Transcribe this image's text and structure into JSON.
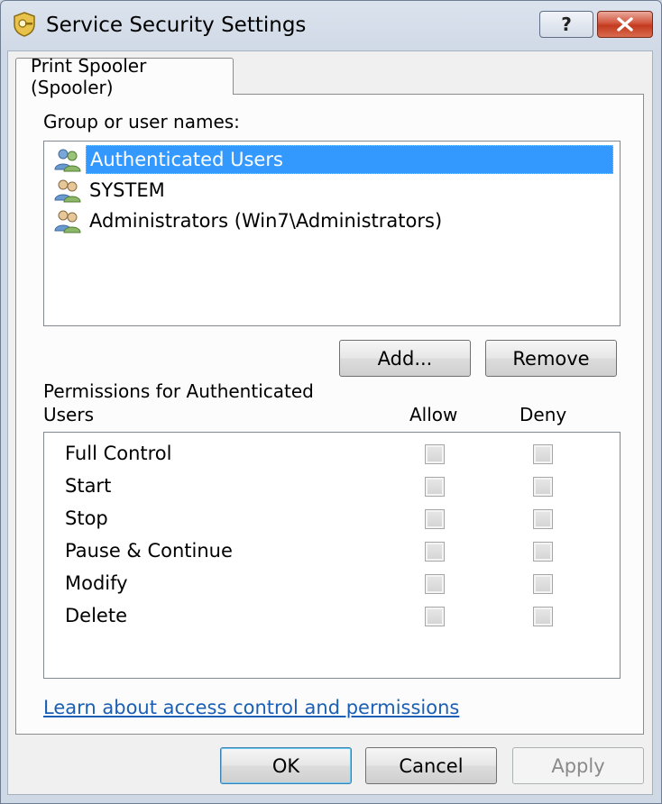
{
  "window": {
    "title": "Service Security Settings",
    "help_label": "?",
    "close_label": "✕"
  },
  "tab": {
    "label": "Print Spooler (Spooler)"
  },
  "groups": {
    "label": "Group or user names:",
    "items": [
      {
        "name": "Authenticated Users",
        "selected": true
      },
      {
        "name": "SYSTEM",
        "selected": false
      },
      {
        "name": "Administrators (Win7\\Administrators)",
        "selected": false
      }
    ],
    "add_label": "Add...",
    "remove_label": "Remove"
  },
  "permissions": {
    "label_line1": "Permissions for Authenticated",
    "label_line2": "Users",
    "allow_header": "Allow",
    "deny_header": "Deny",
    "rows": [
      {
        "name": "Full Control",
        "allow": false,
        "deny": false
      },
      {
        "name": "Start",
        "allow": false,
        "deny": false
      },
      {
        "name": "Stop",
        "allow": false,
        "deny": false
      },
      {
        "name": "Pause & Continue",
        "allow": false,
        "deny": false
      },
      {
        "name": "Modify",
        "allow": false,
        "deny": false
      },
      {
        "name": "Delete",
        "allow": false,
        "deny": false
      }
    ]
  },
  "link": {
    "text": "Learn about access control and permissions"
  },
  "footer": {
    "ok_label": "OK",
    "cancel_label": "Cancel",
    "apply_label": "Apply"
  },
  "colors": {
    "selection": "#3399ff",
    "link": "#1a5fb4",
    "close": "#c33b1f"
  }
}
